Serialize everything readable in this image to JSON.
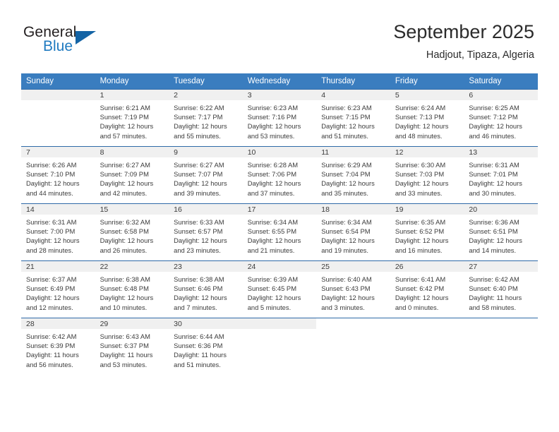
{
  "brand": {
    "name_part1": "General",
    "name_part2": "Blue",
    "flag_icon": "flag-icon",
    "accent_color": "#1464a5",
    "blue_text_color": "#1f7ac0"
  },
  "header": {
    "title": "September 2025",
    "subtitle": "Hadjout, Tipaza, Algeria"
  },
  "calendar": {
    "header_bg": "#3a7dbf",
    "daynum_bg": "#f0f0f0",
    "grid_line_color": "#2f6aa8",
    "weekday_headers": [
      "Sunday",
      "Monday",
      "Tuesday",
      "Wednesday",
      "Thursday",
      "Friday",
      "Saturday"
    ],
    "weeks": [
      [
        {
          "day": "",
          "empty": true,
          "sunrise": "",
          "sunset": "",
          "daylight1": "",
          "daylight2": ""
        },
        {
          "day": "1",
          "sunrise": "Sunrise: 6:21 AM",
          "sunset": "Sunset: 7:19 PM",
          "daylight1": "Daylight: 12 hours",
          "daylight2": "and 57 minutes."
        },
        {
          "day": "2",
          "sunrise": "Sunrise: 6:22 AM",
          "sunset": "Sunset: 7:17 PM",
          "daylight1": "Daylight: 12 hours",
          "daylight2": "and 55 minutes."
        },
        {
          "day": "3",
          "sunrise": "Sunrise: 6:23 AM",
          "sunset": "Sunset: 7:16 PM",
          "daylight1": "Daylight: 12 hours",
          "daylight2": "and 53 minutes."
        },
        {
          "day": "4",
          "sunrise": "Sunrise: 6:23 AM",
          "sunset": "Sunset: 7:15 PM",
          "daylight1": "Daylight: 12 hours",
          "daylight2": "and 51 minutes."
        },
        {
          "day": "5",
          "sunrise": "Sunrise: 6:24 AM",
          "sunset": "Sunset: 7:13 PM",
          "daylight1": "Daylight: 12 hours",
          "daylight2": "and 48 minutes."
        },
        {
          "day": "6",
          "sunrise": "Sunrise: 6:25 AM",
          "sunset": "Sunset: 7:12 PM",
          "daylight1": "Daylight: 12 hours",
          "daylight2": "and 46 minutes."
        }
      ],
      [
        {
          "day": "7",
          "sunrise": "Sunrise: 6:26 AM",
          "sunset": "Sunset: 7:10 PM",
          "daylight1": "Daylight: 12 hours",
          "daylight2": "and 44 minutes."
        },
        {
          "day": "8",
          "sunrise": "Sunrise: 6:27 AM",
          "sunset": "Sunset: 7:09 PM",
          "daylight1": "Daylight: 12 hours",
          "daylight2": "and 42 minutes."
        },
        {
          "day": "9",
          "sunrise": "Sunrise: 6:27 AM",
          "sunset": "Sunset: 7:07 PM",
          "daylight1": "Daylight: 12 hours",
          "daylight2": "and 39 minutes."
        },
        {
          "day": "10",
          "sunrise": "Sunrise: 6:28 AM",
          "sunset": "Sunset: 7:06 PM",
          "daylight1": "Daylight: 12 hours",
          "daylight2": "and 37 minutes."
        },
        {
          "day": "11",
          "sunrise": "Sunrise: 6:29 AM",
          "sunset": "Sunset: 7:04 PM",
          "daylight1": "Daylight: 12 hours",
          "daylight2": "and 35 minutes."
        },
        {
          "day": "12",
          "sunrise": "Sunrise: 6:30 AM",
          "sunset": "Sunset: 7:03 PM",
          "daylight1": "Daylight: 12 hours",
          "daylight2": "and 33 minutes."
        },
        {
          "day": "13",
          "sunrise": "Sunrise: 6:31 AM",
          "sunset": "Sunset: 7:01 PM",
          "daylight1": "Daylight: 12 hours",
          "daylight2": "and 30 minutes."
        }
      ],
      [
        {
          "day": "14",
          "sunrise": "Sunrise: 6:31 AM",
          "sunset": "Sunset: 7:00 PM",
          "daylight1": "Daylight: 12 hours",
          "daylight2": "and 28 minutes."
        },
        {
          "day": "15",
          "sunrise": "Sunrise: 6:32 AM",
          "sunset": "Sunset: 6:58 PM",
          "daylight1": "Daylight: 12 hours",
          "daylight2": "and 26 minutes."
        },
        {
          "day": "16",
          "sunrise": "Sunrise: 6:33 AM",
          "sunset": "Sunset: 6:57 PM",
          "daylight1": "Daylight: 12 hours",
          "daylight2": "and 23 minutes."
        },
        {
          "day": "17",
          "sunrise": "Sunrise: 6:34 AM",
          "sunset": "Sunset: 6:55 PM",
          "daylight1": "Daylight: 12 hours",
          "daylight2": "and 21 minutes."
        },
        {
          "day": "18",
          "sunrise": "Sunrise: 6:34 AM",
          "sunset": "Sunset: 6:54 PM",
          "daylight1": "Daylight: 12 hours",
          "daylight2": "and 19 minutes."
        },
        {
          "day": "19",
          "sunrise": "Sunrise: 6:35 AM",
          "sunset": "Sunset: 6:52 PM",
          "daylight1": "Daylight: 12 hours",
          "daylight2": "and 16 minutes."
        },
        {
          "day": "20",
          "sunrise": "Sunrise: 6:36 AM",
          "sunset": "Sunset: 6:51 PM",
          "daylight1": "Daylight: 12 hours",
          "daylight2": "and 14 minutes."
        }
      ],
      [
        {
          "day": "21",
          "sunrise": "Sunrise: 6:37 AM",
          "sunset": "Sunset: 6:49 PM",
          "daylight1": "Daylight: 12 hours",
          "daylight2": "and 12 minutes."
        },
        {
          "day": "22",
          "sunrise": "Sunrise: 6:38 AM",
          "sunset": "Sunset: 6:48 PM",
          "daylight1": "Daylight: 12 hours",
          "daylight2": "and 10 minutes."
        },
        {
          "day": "23",
          "sunrise": "Sunrise: 6:38 AM",
          "sunset": "Sunset: 6:46 PM",
          "daylight1": "Daylight: 12 hours",
          "daylight2": "and 7 minutes."
        },
        {
          "day": "24",
          "sunrise": "Sunrise: 6:39 AM",
          "sunset": "Sunset: 6:45 PM",
          "daylight1": "Daylight: 12 hours",
          "daylight2": "and 5 minutes."
        },
        {
          "day": "25",
          "sunrise": "Sunrise: 6:40 AM",
          "sunset": "Sunset: 6:43 PM",
          "daylight1": "Daylight: 12 hours",
          "daylight2": "and 3 minutes."
        },
        {
          "day": "26",
          "sunrise": "Sunrise: 6:41 AM",
          "sunset": "Sunset: 6:42 PM",
          "daylight1": "Daylight: 12 hours",
          "daylight2": "and 0 minutes."
        },
        {
          "day": "27",
          "sunrise": "Sunrise: 6:42 AM",
          "sunset": "Sunset: 6:40 PM",
          "daylight1": "Daylight: 11 hours",
          "daylight2": "and 58 minutes."
        }
      ],
      [
        {
          "day": "28",
          "sunrise": "Sunrise: 6:42 AM",
          "sunset": "Sunset: 6:39 PM",
          "daylight1": "Daylight: 11 hours",
          "daylight2": "and 56 minutes."
        },
        {
          "day": "29",
          "sunrise": "Sunrise: 6:43 AM",
          "sunset": "Sunset: 6:37 PM",
          "daylight1": "Daylight: 11 hours",
          "daylight2": "and 53 minutes."
        },
        {
          "day": "30",
          "sunrise": "Sunrise: 6:44 AM",
          "sunset": "Sunset: 6:36 PM",
          "daylight1": "Daylight: 11 hours",
          "daylight2": "and 51 minutes."
        },
        {
          "day": "",
          "empty": true,
          "sunrise": "",
          "sunset": "",
          "daylight1": "",
          "daylight2": ""
        },
        {
          "day": "",
          "blank": true,
          "sunrise": "",
          "sunset": "",
          "daylight1": "",
          "daylight2": ""
        },
        {
          "day": "",
          "blank": true,
          "sunrise": "",
          "sunset": "",
          "daylight1": "",
          "daylight2": ""
        },
        {
          "day": "",
          "blank": true,
          "sunrise": "",
          "sunset": "",
          "daylight1": "",
          "daylight2": ""
        }
      ]
    ]
  }
}
